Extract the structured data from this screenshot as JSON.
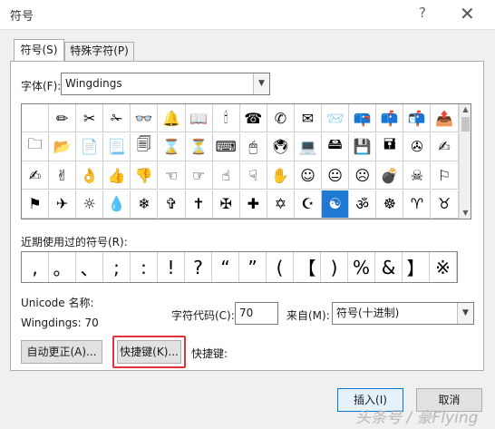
{
  "window": {
    "title": "符号",
    "help": "?",
    "close": "✕"
  },
  "tabs": [
    {
      "label": "符号(S)"
    },
    {
      "label": "特殊字符(P)"
    }
  ],
  "font": {
    "label": "字体(F):",
    "value": "Wingdings"
  },
  "grid": {
    "selected_index": 59,
    "rows": [
      [
        "",
        "✏",
        "✂",
        "✁",
        "👓",
        "🔔",
        "📖",
        "🕯",
        "☎",
        "✆",
        "✉",
        "📨",
        "📪",
        "📫",
        "📬",
        "📤"
      ],
      [
        "🗀",
        "📂",
        "📄",
        "📃",
        "🗐",
        "⌛",
        "⏳",
        "⌨",
        "🖱",
        "🖲",
        "💻",
        "🖴",
        "💾",
        "🖬",
        "✇",
        "✍"
      ],
      [
        "✍",
        "✌",
        "👌",
        "👍",
        "👎",
        "☜",
        "☞",
        "☝",
        "☟",
        "✋",
        "☺",
        "😐",
        "☹",
        "💣",
        "☠",
        "⚐"
      ],
      [
        "⚑",
        "✈",
        "☼",
        "💧",
        "❄",
        "✞",
        "✝",
        "✠",
        "✚",
        "✡",
        "☪",
        "☯",
        "ॐ",
        "☸",
        "♈",
        "♉"
      ]
    ]
  },
  "recent": {
    "label": "近期使用过的符号(R):",
    "symbols": [
      ",",
      "。",
      "、",
      ";",
      ":",
      "!",
      "?",
      "“",
      "”",
      "(",
      "【",
      ")",
      "%",
      "&",
      "】",
      "※"
    ]
  },
  "info": {
    "unicode_name_label": "Unicode 名称:",
    "font_code_text": "Wingdings: 70",
    "code_label": "字符代码(C):",
    "code_value": "70",
    "from_label": "来自(M):",
    "from_value": "符号(十进制)"
  },
  "buttons": {
    "autocorrect": "自动更正(A)...",
    "shortcut": "快捷键(K)...",
    "shortcut_label": "快捷键:",
    "insert": "插入(I)",
    "cancel": "取消"
  },
  "watermark": "头条号 / 豪Flying",
  "colors": {
    "selected": "#1f78d1",
    "highlight": "#e0343a"
  }
}
